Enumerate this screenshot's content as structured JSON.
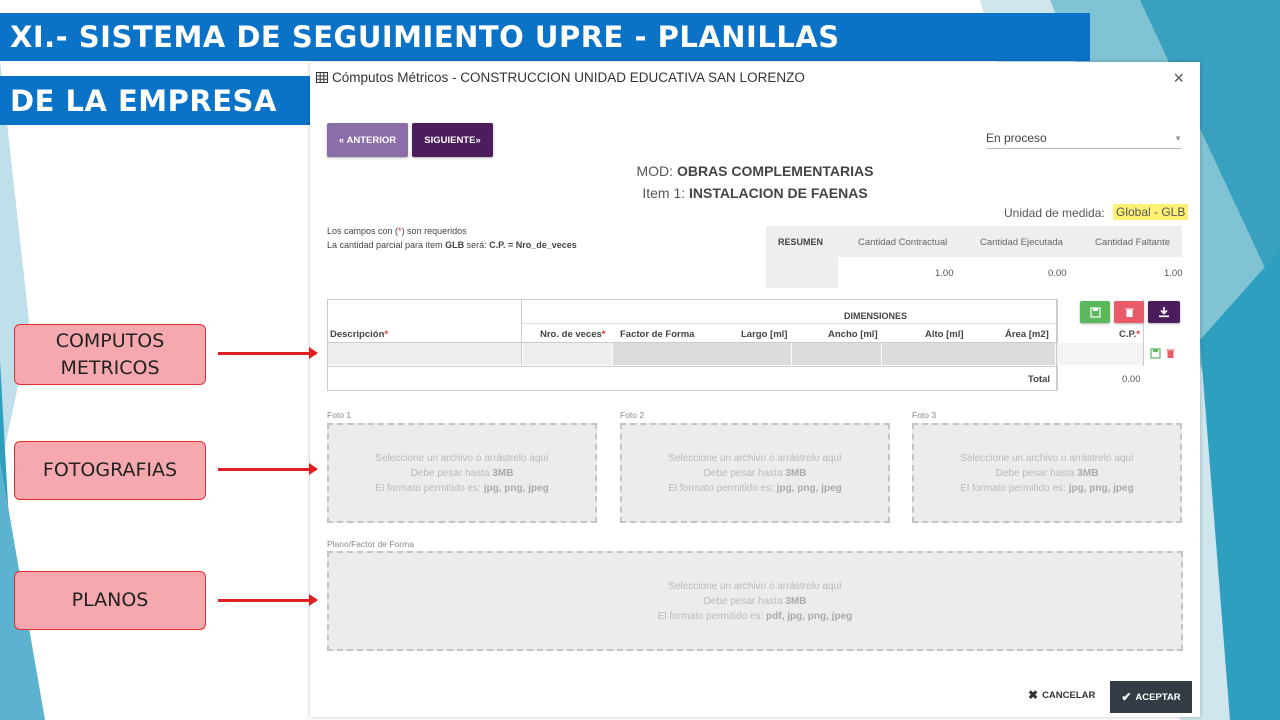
{
  "slide": {
    "title_line1": "XI.- SISTEMA DE SEGUIMIENTO UPRE - PLANILLAS",
    "title_line2": "DE LA EMPRESA"
  },
  "callouts": [
    {
      "label": "COMPUTOS\nMETRICOS"
    },
    {
      "label": "FOTOGRAFIAS"
    },
    {
      "label": "PLANOS"
    }
  ],
  "modal": {
    "title": "Cómputos Métricos - CONSTRUCCION UNIDAD EDUCATIVA SAN LORENZO",
    "close": "×",
    "btn_prev": "« ANTERIOR",
    "btn_next": "SIGUIENTE»",
    "status_value": "En proceso",
    "mod_prefix": "MOD:",
    "mod_value": "OBRAS COMPLEMENTARIAS",
    "item_prefix": "Item 1:",
    "item_value": "INSTALACION DE FAENAS",
    "unit_label": "Unidad de medida:",
    "unit_value": "Global - GLB",
    "note_line1_a": "Los campos con (",
    "note_line1_b": "*",
    "note_line1_c": ") son requeridos",
    "note_line2_a": "La cantidad parcial para item",
    "note_line2_b": "GLB",
    "note_line2_c": "será:",
    "note_line2_d": "C.P. = Nro_de_veces",
    "summary": {
      "header": "RESUMEN",
      "col1": "Cantidad Contractual",
      "col2": "Cantidad Ejecutada",
      "col3": "Cantidad Faltante",
      "val1": "1.00",
      "val2": "0.00",
      "val3": "1.00"
    },
    "table": {
      "group_header": "DIMENSIONES",
      "col_desc": "Descripción",
      "col_nro": "Nro. de veces",
      "col_factor": "Factor de Forma",
      "col_largo": "Largo [ml]",
      "col_ancho": "Ancho [ml]",
      "col_alto": "Alto [ml]",
      "col_area": "Área [m2]",
      "col_cp": "C.P.",
      "req": "*",
      "total_label": "Total",
      "total_value": "0.00"
    },
    "photos": {
      "label1": "Foto 1",
      "label2": "Foto 2",
      "label3": "Foto 3",
      "line1": "Seleccione un archivo o arrástrelo aquí",
      "line2_a": "Debe pesar hasta",
      "line2_b": "3MB",
      "line3_a": "El formato permitido es:",
      "line3_b": "jpg, png, jpeg"
    },
    "plano": {
      "label": "Plano/Factor de Forma",
      "line1": "Seleccione un archivo o arrástrelo aquí",
      "line2_a": "Debe pesar hasta",
      "line2_b": "3MB",
      "line3_a": "El formato permitido es:",
      "line3_b": "pdf, jpg, png, jpeg"
    },
    "btn_cancel": "CANCELAR",
    "btn_accept": "ACEPTAR"
  },
  "colors": {
    "title_bar": "#0b73c7",
    "btn_prev": "#8b6ea8",
    "btn_next": "#4b1d5c",
    "btn_save": "#5cb85c",
    "btn_delete": "#e85c6a",
    "btn_download": "#4b1d5c",
    "callout_fill": "#f5a9ae",
    "arrow": "#e02020"
  }
}
